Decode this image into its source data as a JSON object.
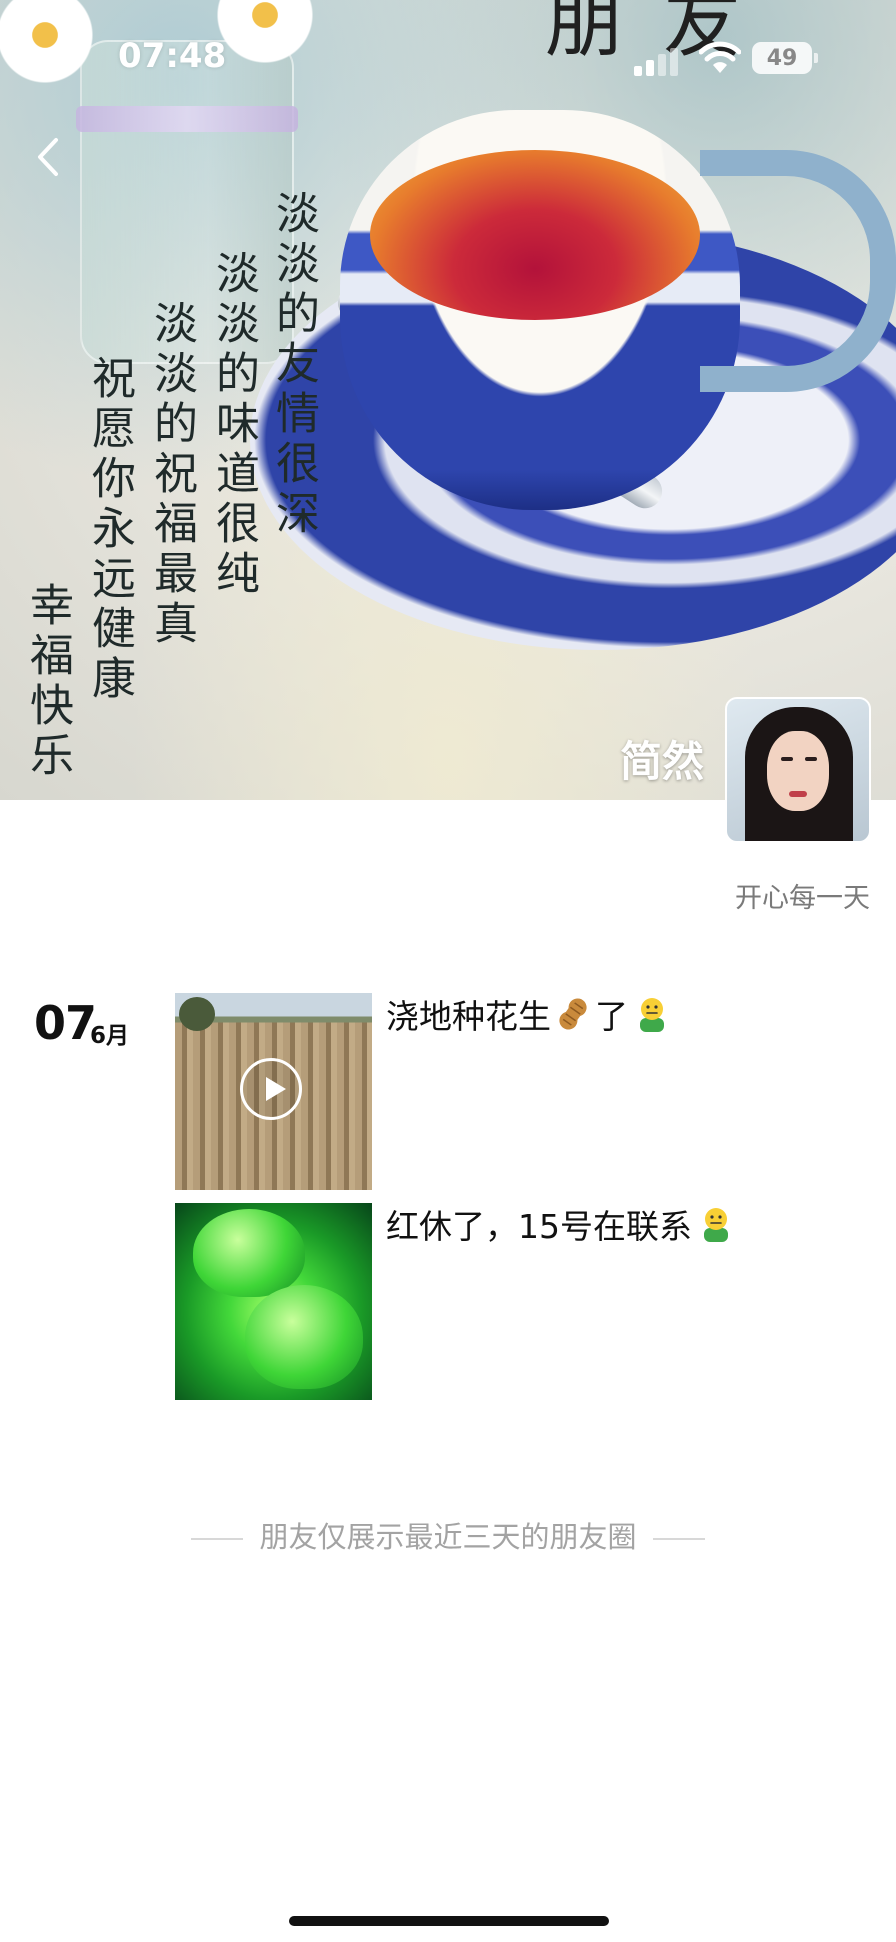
{
  "status_bar": {
    "time": "07:48",
    "battery": "49"
  },
  "cover": {
    "title_fragment": "朋友",
    "poem_lines": [
      "淡淡的友情很深",
      "淡淡的味道很纯",
      "淡淡的祝福最真",
      "祝愿你永远健康",
      "幸福快乐"
    ]
  },
  "profile": {
    "nickname": "简然",
    "signature": "开心每一天"
  },
  "feed": {
    "date": {
      "day": "07",
      "month": "6月"
    },
    "posts": [
      {
        "text_before": "浇地种花生",
        "text_after": "了",
        "emojis": [
          "peanut-icon",
          "face-icon"
        ],
        "has_video": true
      },
      {
        "text": "红休了，15号在联系",
        "emojis": [
          "face-icon"
        ],
        "has_video": false
      }
    ]
  },
  "notice": "朋友仅展示最近三天的朋友圈"
}
